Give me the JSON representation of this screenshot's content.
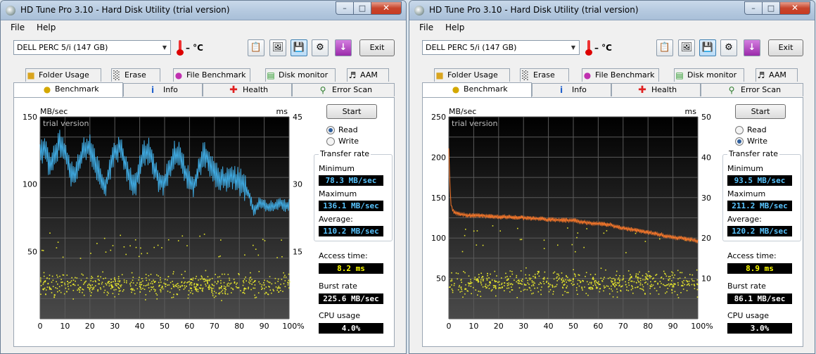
{
  "windows": [
    {
      "id": "left",
      "title": "HD Tune Pro 3.10 - Hard Disk Utility (trial version)",
      "menu": [
        "File",
        "Help"
      ],
      "drive": "DELL   PERC 5/i (147 GB)",
      "temperature": "– °C",
      "exit_label": "Exit",
      "tabs_row1": [
        {
          "label": "Folder Usage",
          "icon": "folder-icon"
        },
        {
          "label": "Erase",
          "icon": "trash-icon"
        },
        {
          "label": "File Benchmark",
          "icon": "file-benchmark-icon"
        },
        {
          "label": "Disk monitor",
          "icon": "disk-monitor-icon"
        },
        {
          "label": "AAM",
          "icon": "speaker-icon"
        }
      ],
      "tabs_row2": [
        {
          "label": "Benchmark",
          "icon": "lightbulb-icon",
          "selected": true
        },
        {
          "label": "Info",
          "icon": "info-icon"
        },
        {
          "label": "Health",
          "icon": "health-cross-icon"
        },
        {
          "label": "Error Scan",
          "icon": "magnifier-icon"
        }
      ],
      "start_label": "Start",
      "mode": {
        "read": "Read",
        "write": "Write",
        "selected": "read"
      },
      "transfer_rate": {
        "title": "Transfer rate",
        "minimum_label": "Minimum",
        "minimum": "78.3 MB/sec",
        "maximum_label": "Maximum",
        "maximum": "136.1 MB/sec",
        "average_label": "Average:",
        "average": "110.2 MB/sec"
      },
      "access_time_label": "Access time:",
      "access_time": "8.2 ms",
      "burst_rate_label": "Burst rate",
      "burst_rate": "225.6 MB/sec",
      "cpu_usage_label": "CPU usage",
      "cpu_usage": "4.0%",
      "chart_data": {
        "type": "line",
        "watermark": "trial version",
        "y_left_unit": "MB/sec",
        "y_right_unit": "ms",
        "y_left_ticks": [
          "150",
          "100",
          "50"
        ],
        "y_left_range": [
          0,
          150
        ],
        "y_right_ticks": [
          "45",
          "30",
          "15"
        ],
        "y_right_range": [
          0,
          45
        ],
        "x_ticks": [
          "0",
          "10",
          "20",
          "30",
          "40",
          "50",
          "60",
          "70",
          "80",
          "90",
          "100%"
        ],
        "x_range": [
          0,
          100
        ],
        "grid": true,
        "series": [
          {
            "kind": "transfer-rate",
            "color": "#3fa9e0",
            "points": [
              [
                0,
                122
              ],
              [
                2,
                128
              ],
              [
                4,
                112
              ],
              [
                6,
                124
              ],
              [
                8,
                130
              ],
              [
                10,
                126
              ],
              [
                12,
                110
              ],
              [
                14,
                104
              ],
              [
                16,
                118
              ],
              [
                18,
                127
              ],
              [
                20,
                128
              ],
              [
                22,
                116
              ],
              [
                24,
                105
              ],
              [
                26,
                96
              ],
              [
                28,
                112
              ],
              [
                30,
                124
              ],
              [
                32,
                128
              ],
              [
                34,
                117
              ],
              [
                36,
                104
              ],
              [
                38,
                98
              ],
              [
                40,
                112
              ],
              [
                42,
                124
              ],
              [
                44,
                124
              ],
              [
                46,
                112
              ],
              [
                48,
                103
              ],
              [
                50,
                101
              ],
              [
                52,
                113
              ],
              [
                54,
                122
              ],
              [
                56,
                121
              ],
              [
                58,
                110
              ],
              [
                60,
                103
              ],
              [
                62,
                100
              ],
              [
                64,
                114
              ],
              [
                66,
                123
              ],
              [
                68,
                116
              ],
              [
                70,
                110
              ],
              [
                72,
                104
              ],
              [
                74,
                102
              ],
              [
                76,
                106
              ],
              [
                78,
                104
              ],
              [
                80,
                102
              ],
              [
                82,
                98
              ],
              [
                84,
                91
              ],
              [
                86,
                80
              ],
              [
                88,
                87
              ],
              [
                90,
                85
              ],
              [
                92,
                83
              ],
              [
                94,
                84
              ],
              [
                96,
                86
              ],
              [
                98,
                84
              ],
              [
                100,
                84
              ]
            ]
          }
        ],
        "access_time_scatter": {
          "color": "#e6e62c",
          "y_range_ms": [
            0,
            15
          ]
        }
      }
    },
    {
      "id": "right",
      "title": "HD Tune Pro 3.10 - Hard Disk Utility (trial version)",
      "menu": [
        "File",
        "Help"
      ],
      "drive": "DELL   PERC 5/i (147 GB)",
      "temperature": "– °C",
      "exit_label": "Exit",
      "tabs_row1": [
        {
          "label": "Folder Usage",
          "icon": "folder-icon"
        },
        {
          "label": "Erase",
          "icon": "trash-icon"
        },
        {
          "label": "File Benchmark",
          "icon": "file-benchmark-icon"
        },
        {
          "label": "Disk monitor",
          "icon": "disk-monitor-icon"
        },
        {
          "label": "AAM",
          "icon": "speaker-icon"
        }
      ],
      "tabs_row2": [
        {
          "label": "Benchmark",
          "icon": "lightbulb-icon",
          "selected": true
        },
        {
          "label": "Info",
          "icon": "info-icon"
        },
        {
          "label": "Health",
          "icon": "health-cross-icon"
        },
        {
          "label": "Error Scan",
          "icon": "magnifier-icon"
        }
      ],
      "start_label": "Start",
      "mode": {
        "read": "Read",
        "write": "Write",
        "selected": "write"
      },
      "transfer_rate": {
        "title": "Transfer rate",
        "minimum_label": "Minimum",
        "minimum": "93.5 MB/sec",
        "maximum_label": "Maximum",
        "maximum": "211.2 MB/sec",
        "average_label": "Average:",
        "average": "120.2 MB/sec"
      },
      "access_time_label": "Access time:",
      "access_time": "8.9 ms",
      "burst_rate_label": "Burst rate",
      "burst_rate": "86.1 MB/sec",
      "cpu_usage_label": "CPU usage",
      "cpu_usage": "3.0%",
      "chart_data": {
        "type": "line",
        "watermark": "trial version",
        "y_left_unit": "MB/sec",
        "y_right_unit": "ms",
        "y_left_ticks": [
          "250",
          "200",
          "150",
          "100",
          "50"
        ],
        "y_left_range": [
          0,
          250
        ],
        "y_right_ticks": [
          "50",
          "40",
          "30",
          "20",
          "10"
        ],
        "y_right_range": [
          0,
          50
        ],
        "x_ticks": [
          "0",
          "10",
          "20",
          "30",
          "40",
          "50",
          "60",
          "70",
          "80",
          "90",
          "100%"
        ],
        "x_range": [
          0,
          100
        ],
        "grid": true,
        "series": [
          {
            "kind": "transfer-rate",
            "color": "#ff7a2a",
            "points": [
              [
                0,
                211
              ],
              [
                0.5,
                160
              ],
              [
                1,
                138
              ],
              [
                2,
                132
              ],
              [
                4,
                130
              ],
              [
                8,
                128
              ],
              [
                12,
                128
              ],
              [
                16,
                127
              ],
              [
                20,
                126
              ],
              [
                25,
                126
              ],
              [
                30,
                125
              ],
              [
                35,
                124
              ],
              [
                40,
                123
              ],
              [
                45,
                122
              ],
              [
                50,
                122
              ],
              [
                55,
                119
              ],
              [
                60,
                118
              ],
              [
                65,
                116
              ],
              [
                70,
                112
              ],
              [
                75,
                110
              ],
              [
                80,
                107
              ],
              [
                85,
                104
              ],
              [
                90,
                101
              ],
              [
                95,
                99
              ],
              [
                98,
                98
              ],
              [
                100,
                95
              ]
            ]
          }
        ],
        "access_time_scatter": {
          "color": "#e6e62c",
          "y_range_ms": [
            0,
            18
          ]
        }
      }
    }
  ]
}
